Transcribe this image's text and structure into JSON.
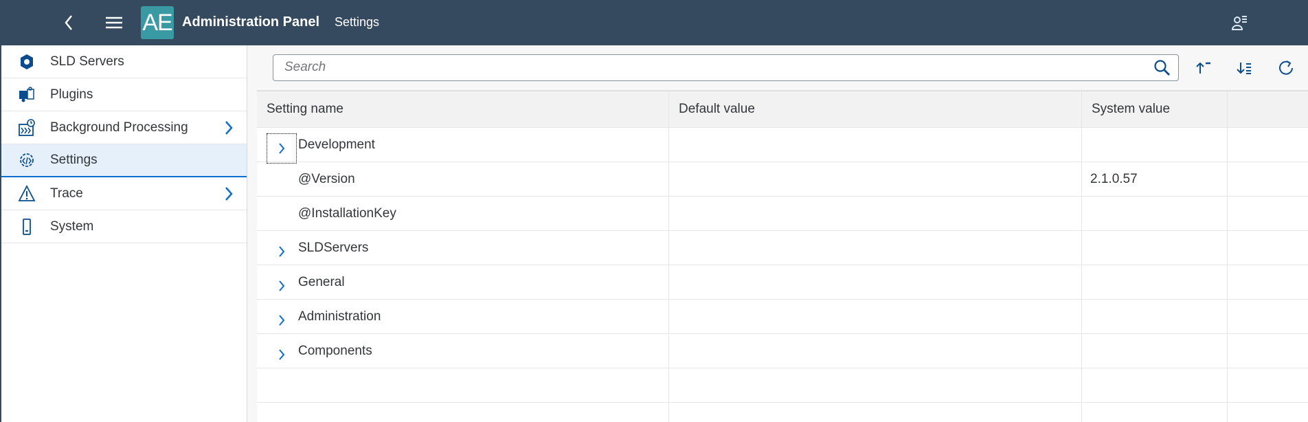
{
  "header": {
    "logo": "AE",
    "title": "Administration Panel",
    "subtitle": "Settings",
    "color": "#354a5f"
  },
  "sidebar": {
    "items": [
      {
        "label": "SLD Servers",
        "icon": "sld-servers-icon",
        "has_children": false,
        "selected": false
      },
      {
        "label": "Plugins",
        "icon": "puzzle-icon",
        "has_children": false,
        "selected": false
      },
      {
        "label": "Background Processing",
        "icon": "background-processing-icon",
        "has_children": true,
        "selected": false
      },
      {
        "label": "Settings",
        "icon": "settings-code-icon",
        "has_children": false,
        "selected": true
      },
      {
        "label": "Trace",
        "icon": "warning-icon",
        "has_children": true,
        "selected": false
      },
      {
        "label": "System",
        "icon": "mobile-device-icon",
        "has_children": false,
        "selected": false
      }
    ]
  },
  "search": {
    "placeholder": "Search",
    "value": ""
  },
  "table": {
    "columns": [
      "Setting name",
      "Default value",
      "System value",
      ""
    ],
    "rows": [
      {
        "name": "Development",
        "expandable": true,
        "default": "",
        "system": ""
      },
      {
        "name": "@Version",
        "expandable": false,
        "default": "",
        "system": "2.1.0.57"
      },
      {
        "name": "@InstallationKey",
        "expandable": false,
        "default": "",
        "system": ""
      },
      {
        "name": "SLDServers",
        "expandable": true,
        "default": "",
        "system": ""
      },
      {
        "name": "General",
        "expandable": true,
        "default": "",
        "system": ""
      },
      {
        "name": "Administration",
        "expandable": true,
        "default": "",
        "system": ""
      },
      {
        "name": "Components",
        "expandable": true,
        "default": "",
        "system": ""
      },
      {
        "name": "",
        "expandable": false,
        "default": "",
        "system": ""
      },
      {
        "name": "",
        "expandable": false,
        "default": "",
        "system": ""
      }
    ]
  },
  "accent": "#0a6ed1"
}
